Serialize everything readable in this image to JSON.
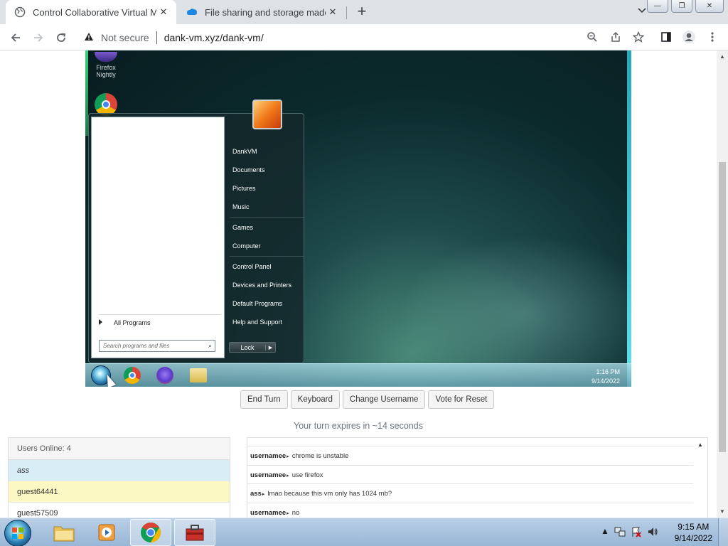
{
  "browser": {
    "tabs": [
      {
        "title": "Control Collaborative Virtual Mac",
        "active": true
      },
      {
        "title": "File sharing and storage made sir",
        "active": false
      }
    ],
    "address": {
      "security_label": "Not secure",
      "url": "dank-vm.xyz/dank-vm/"
    }
  },
  "vm": {
    "desktop_icons": [
      {
        "label": "Firefox Nightly"
      }
    ],
    "start_menu": {
      "right_items": [
        "DankVM",
        "Documents",
        "Pictures",
        "Music",
        "Games",
        "Computer",
        "Control Panel",
        "Devices and Printers",
        "Default Programs",
        "Help and Support"
      ],
      "all_programs": "All Programs",
      "search_placeholder": "Search programs and files",
      "lock_label": "Lock"
    },
    "clock": {
      "time": "1:16 PM",
      "date": "9/14/2022"
    }
  },
  "controls": {
    "end_turn": "End Turn",
    "keyboard": "Keyboard",
    "change_username": "Change Username",
    "vote_reset": "Vote for Reset"
  },
  "turn_status": "Your turn expires in ~14 seconds",
  "users": {
    "header": "Users Online: 4",
    "list": [
      "ass",
      "guest64441",
      "guest57509"
    ]
  },
  "chat": {
    "messages": [
      {
        "user": "usernamee",
        "text": "chrome is unstable"
      },
      {
        "user": "usernamee",
        "text": "use firefox"
      },
      {
        "user": "ass",
        "text": "lmao because this vm only has 1024 mb?"
      },
      {
        "user": "usernamee",
        "text": "no"
      }
    ]
  },
  "host": {
    "clock": {
      "time": "9:15 AM",
      "date": "9/14/2022"
    }
  }
}
